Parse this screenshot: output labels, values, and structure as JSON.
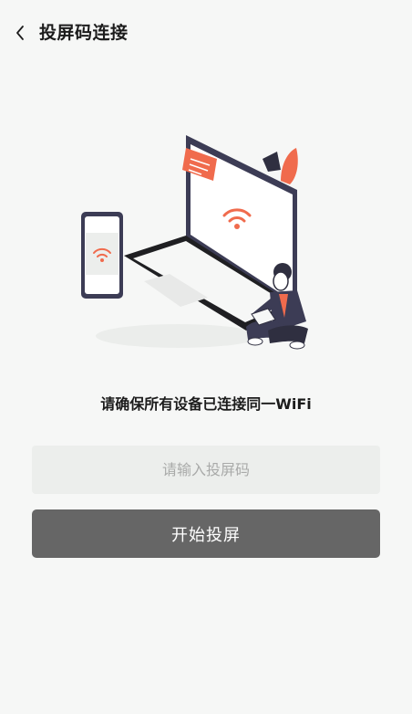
{
  "header": {
    "title": "投屏码连接",
    "back_icon": "chevron-left-icon"
  },
  "illustration": {
    "name": "person-with-laptop-and-phone-wifi",
    "icons": [
      "wifi-icon",
      "wifi-icon"
    ],
    "colors": {
      "accent": "#f06b4d",
      "device_frame": "#3c3c55",
      "laptop_base": "#1f1f22"
    }
  },
  "prompt": {
    "text": "请确保所有设备已连接同一WiFi"
  },
  "code_input": {
    "value": "",
    "placeholder": "请输入投屏码"
  },
  "start_button": {
    "label": "开始投屏"
  },
  "colors": {
    "background": "#f6f7f6",
    "input_background": "#eceeec",
    "button_background": "#666666",
    "button_text": "#ffffff"
  }
}
